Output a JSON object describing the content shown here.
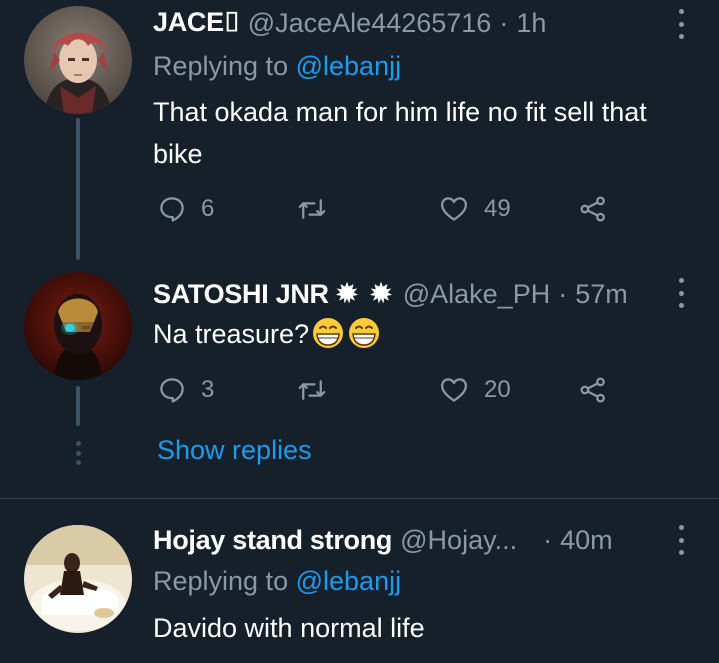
{
  "tweets": [
    {
      "name": "JACE⌷",
      "handle": "@JaceAle44265716",
      "time": "1h",
      "replying_prefix": "Replying to",
      "replying_to": "@lebanjj",
      "text": "That okada man for him life no fit sell that bike",
      "replies": "6",
      "retweets": "",
      "likes": "49"
    },
    {
      "name": "SATOSHI JNR",
      "handle": "@Alake_PH",
      "time": "57m",
      "text": "Na treasure?",
      "replies": "3",
      "retweets": "",
      "likes": "20",
      "show_replies": "Show replies"
    },
    {
      "name": "Hojay stand strong",
      "handle": "@Hojay...",
      "time": "40m",
      "replying_prefix": "Replying to",
      "replying_to": "@lebanjj",
      "text": "Davido with normal life"
    }
  ],
  "icons": {
    "reply": "speech-bubble-icon",
    "retweet": "retweet-arrows-icon",
    "like": "heart-icon",
    "share": "share-nodes-icon",
    "more": "vertical-ellipsis-icon",
    "badge": "anger-burst-emoji",
    "laugh": "grinning-squinting-emoji"
  },
  "colors": {
    "background": "#15202b",
    "primary_text": "#ffffff",
    "secondary_text": "#8b98a5",
    "link": "#1d9bf0",
    "divider": "#38444d"
  }
}
